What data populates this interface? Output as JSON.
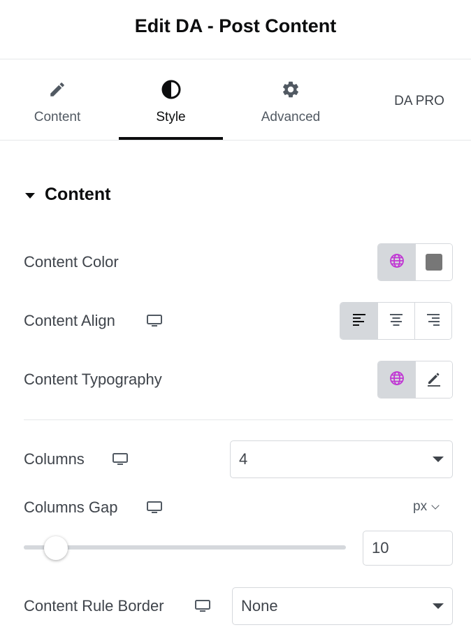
{
  "header": {
    "title": "Edit DA - Post Content"
  },
  "tabs": [
    {
      "label": "Content",
      "icon": "pencil-icon"
    },
    {
      "label": "Style",
      "icon": "contrast-icon",
      "active": true
    },
    {
      "label": "Advanced",
      "icon": "gear-icon"
    },
    {
      "label": "DA PRO"
    }
  ],
  "section": {
    "title": "Content",
    "expanded": true
  },
  "controls": {
    "content_color": {
      "label": "Content Color",
      "global_icon": "globe-icon",
      "swatch_color": "#777777"
    },
    "content_align": {
      "label": "Content Align",
      "device_icon": "desktop-icon",
      "options": [
        "align-left-icon",
        "align-center-icon",
        "align-right-icon"
      ],
      "selected": "align-left-icon"
    },
    "content_typography": {
      "label": "Content Typography",
      "global_icon": "globe-icon",
      "edit_icon": "pencil-icon"
    },
    "columns": {
      "label": "Columns",
      "device_icon": "desktop-icon",
      "value": "4"
    },
    "columns_gap": {
      "label": "Columns Gap",
      "device_icon": "desktop-icon",
      "unit": "px",
      "value": "10",
      "slider_fraction": 0.1
    },
    "content_rule_border": {
      "label": "Content Rule Border",
      "device_icon": "desktop-icon",
      "value": "None"
    }
  },
  "colors": {
    "accent_global": "#c036d3",
    "text": "#3f444b",
    "heading": "#0c0d0e",
    "border": "#d5d8dc",
    "active_segment": "#d5d8dc"
  }
}
